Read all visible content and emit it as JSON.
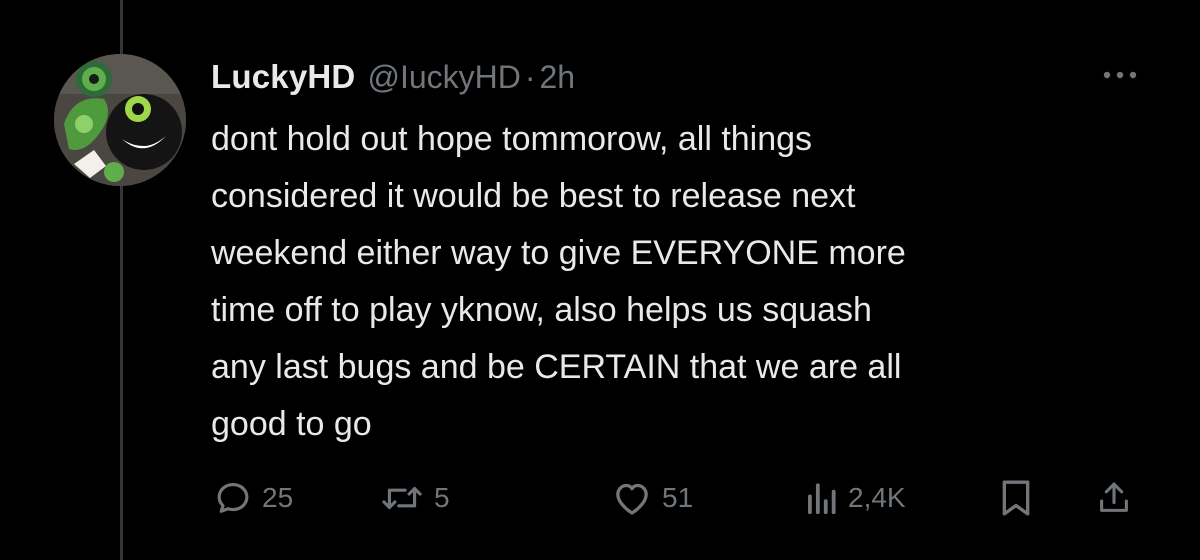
{
  "tweet": {
    "author": {
      "name": "LuckyHD",
      "handle": "@IuckyHD",
      "avatar": "cartoon-character-avatar"
    },
    "separator": "·",
    "time": "2h",
    "text": "dont hold out hope tommorow, all things\nconsidered it would be best to release next\nweekend either way to give EVERYONE more\ntime off to play yknow, also helps us squash\nany last bugs and be CERTAIN that we are all\ngood to go",
    "more_icon": "more-horizontal-icon"
  },
  "actions": {
    "reply": {
      "icon": "reply-icon",
      "count": "25"
    },
    "retweet": {
      "icon": "retweet-icon",
      "count": "5"
    },
    "like": {
      "icon": "heart-icon",
      "count": "51"
    },
    "views": {
      "icon": "views-icon",
      "count": "2,4K"
    },
    "bookmark": {
      "icon": "bookmark-icon"
    },
    "share": {
      "icon": "share-icon"
    }
  },
  "colors": {
    "background": "#000000",
    "text": "#e7e9ea",
    "muted": "#71767b",
    "thread_line": "#333639"
  }
}
